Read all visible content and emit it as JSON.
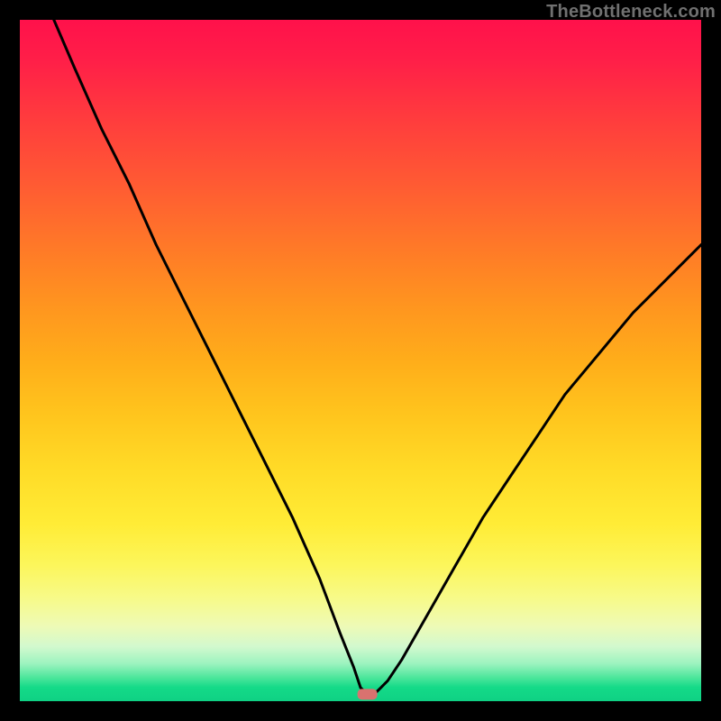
{
  "watermark": "TheBottleneck.com",
  "chart_data": {
    "type": "line",
    "title": "",
    "xlabel": "",
    "ylabel": "",
    "xlim": [
      0,
      100
    ],
    "ylim": [
      0,
      100
    ],
    "grid": false,
    "legend": false,
    "series": [
      {
        "name": "bottleneck-curve",
        "x": [
          5,
          8,
          12,
          16,
          20,
          24,
          28,
          32,
          36,
          40,
          44,
          47,
          49,
          50,
          51,
          52,
          53,
          54,
          56,
          60,
          64,
          68,
          72,
          76,
          80,
          85,
          90,
          95,
          100
        ],
        "y": [
          100,
          93,
          84,
          76,
          67,
          59,
          51,
          43,
          35,
          27,
          18,
          10,
          5,
          2,
          1,
          1,
          2,
          3,
          6,
          13,
          20,
          27,
          33,
          39,
          45,
          51,
          57,
          62,
          67
        ]
      }
    ],
    "marker": {
      "x": 51,
      "y": 1
    },
    "background_gradient": {
      "orientation": "vertical",
      "stops": [
        {
          "pos": 0.0,
          "color": "#ff114b"
        },
        {
          "pos": 0.5,
          "color": "#ffad1a"
        },
        {
          "pos": 0.8,
          "color": "#fcf65b"
        },
        {
          "pos": 0.93,
          "color": "#9cf3bf"
        },
        {
          "pos": 1.0,
          "color": "#0fd184"
        }
      ]
    }
  }
}
